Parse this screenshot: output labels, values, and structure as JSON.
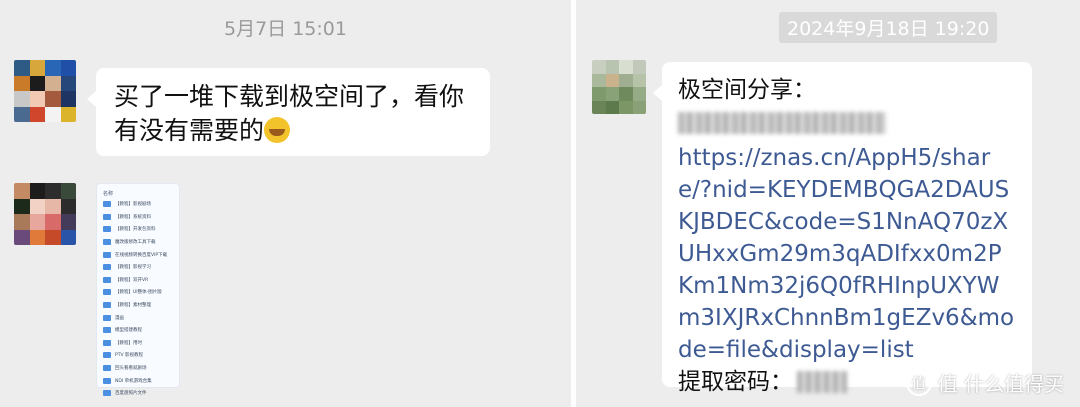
{
  "left": {
    "timestamp": "5月7日 15:01",
    "message_text": "买了一堆下载到极空间了，看你有没有需要的",
    "emoji_icon": "grinning-sweat-emoji-icon",
    "file_list": {
      "header": "名称",
      "items": [
        "【教程】影视剧场",
        "【教程】系统资料",
        "【教程】开发包资料",
        "魔改版修改工具下载",
        "在线视频转换百度VIP下载",
        "【教程】影视学习",
        "【教程】双开VR",
        "【教程】UI整体-图片版",
        "【教程】素材整理",
        "漫画",
        "模型搭建教程",
        "【教程】用时",
        "PTV 影视教程",
        "回头看看就剧场",
        "NDI 单机游戏合集",
        "百度盘照片文件"
      ]
    }
  },
  "right": {
    "timestamp": "2024年9月18日 19:20",
    "share_title": "极空间分享：",
    "link": "https://znas.cn/AppH5/share/?nid=KEYDEMBQGA2DAUSKJBDEC&code=S1NnAQ70zXUHxxGm29m3qADIfxx0m2PKm1Nm32j6Q0fRHInpUXYWm3IXJRxChnnBm1gEZv6&mode=file&display=list",
    "code_label": "提取密码："
  },
  "watermark": "值 什么值得买",
  "colors": {
    "panel_bg": "#ededed",
    "bubble_bg": "#ffffff",
    "link": "#3e5a93",
    "timestamp": "#9a9a9a"
  }
}
